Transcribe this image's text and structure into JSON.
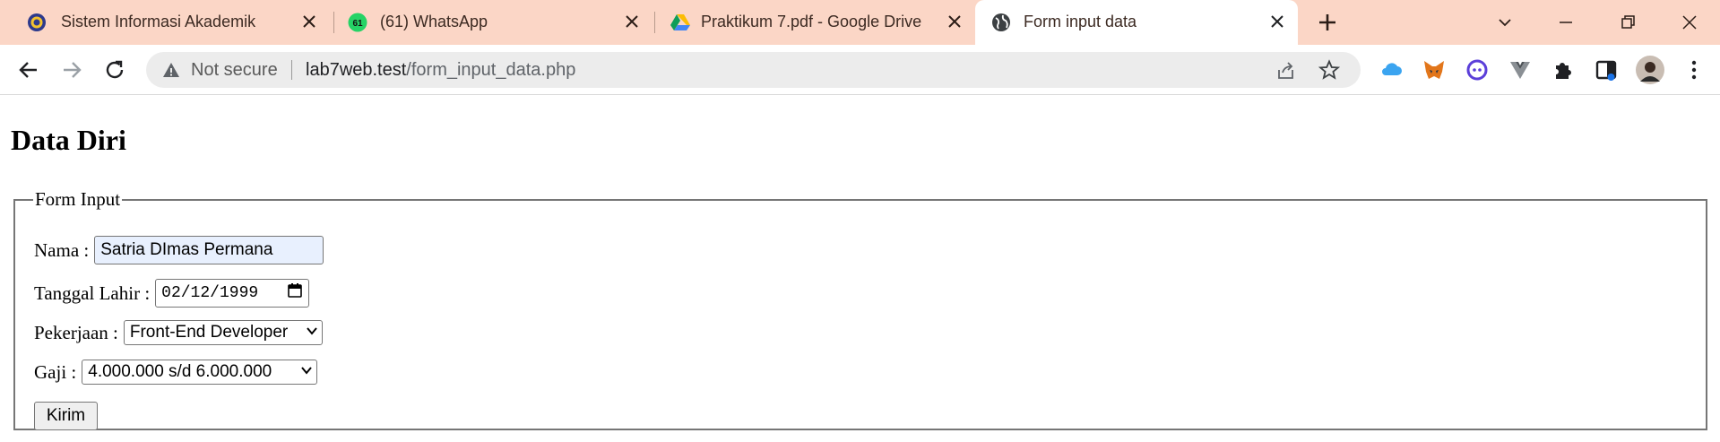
{
  "browser": {
    "tabs": [
      {
        "title": "Sistem Informasi Akademik",
        "icon": "university-logo-icon"
      },
      {
        "title": "(61) WhatsApp",
        "icon": "whatsapp-icon",
        "badge": "61"
      },
      {
        "title": "Praktikum 7.pdf - Google Drive",
        "icon": "google-drive-icon"
      },
      {
        "title": "Form input data",
        "icon": "globe-icon",
        "active": true
      }
    ],
    "address": {
      "security_label": "Not secure",
      "host": "lab7web.test",
      "path": "/form_input_data.php"
    }
  },
  "page": {
    "heading": "Data Diri",
    "form": {
      "legend": "Form Input",
      "nama_label": "Nama :",
      "nama_value": "Satria DImas Permana",
      "tanggal_label": "Tanggal Lahir :",
      "tanggal_value": "02/12/1999",
      "pekerjaan_label": "Pekerjaan :",
      "pekerjaan_value": "Front-End Developer",
      "gaji_label": "Gaji :",
      "gaji_value": "4.000.000 s/d 6.000.000",
      "submit_label": "Kirim"
    }
  },
  "colors": {
    "tabstrip": "#fbd6c6",
    "autofill": "#e8f0fe"
  }
}
